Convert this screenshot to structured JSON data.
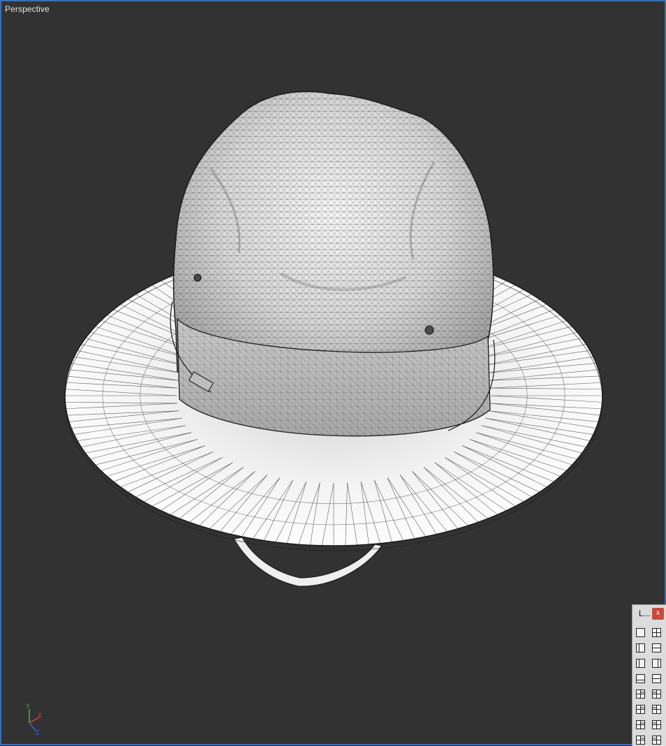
{
  "viewport": {
    "label": "Perspective",
    "background": "#323232",
    "border_color": "#3c6fb4"
  },
  "model": {
    "name": "hat-mesh-wireframe",
    "shading": "smooth-with-wireframe"
  },
  "axis_gizmo": {
    "y_label": "Y",
    "x_label": "X",
    "z_label": "Z"
  },
  "layout_panel": {
    "title": "L...",
    "close_label": "x",
    "icons": [
      "layout-single-icon",
      "layout-quad-icon",
      "layout-vertical-split-icon",
      "layout-horizontal-split-icon",
      "layout-left-panel-icon",
      "layout-right-panel-icon",
      "layout-bottom-panel-icon",
      "layout-top-panel-icon",
      "layout-three-left-icon",
      "layout-three-right-icon",
      "layout-three-top-icon",
      "layout-three-bottom-icon",
      "layout-four-left-icon",
      "layout-four-right-icon",
      "layout-four-top-icon",
      "layout-four-bottom-icon"
    ]
  }
}
